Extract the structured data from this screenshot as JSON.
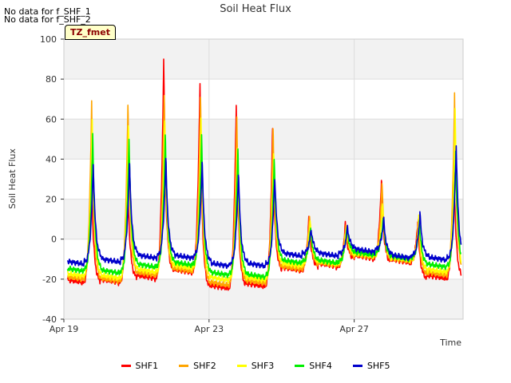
{
  "notices": [
    "No data for f_SHF_1",
    "No data for f_SHF_2"
  ],
  "badge": "TZ_fmet",
  "chart_data": {
    "type": "line",
    "title": "Soil Heat Flux",
    "xlabel": "Time",
    "ylabel": "Soil Heat Flux",
    "ylim": [
      -40,
      100
    ],
    "yticks": [
      -40,
      -20,
      0,
      20,
      40,
      60,
      80,
      100
    ],
    "xlim_days": [
      0,
      11
    ],
    "xticks": [
      {
        "label": "Apr 19",
        "day": 0
      },
      {
        "label": "Apr 23",
        "day": 4
      },
      {
        "label": "Apr 27",
        "day": 8
      }
    ],
    "grid": true,
    "legend_position": "bottom",
    "peak_days": [
      0.75,
      1.75,
      2.7,
      3.7,
      4.7,
      5.7,
      6.7,
      7.7,
      8.7,
      9.7,
      10.7
    ],
    "series": [
      {
        "name": "SHF1",
        "color": "#ff0000",
        "peaks": [
          40,
          36,
          90,
          79,
          68,
          55,
          10,
          7,
          30,
          8,
          32
        ],
        "nights": [
          -22,
          -22,
          -20,
          -17,
          -25,
          -24,
          -16,
          -14,
          -10,
          -12,
          -20
        ]
      },
      {
        "name": "SHF2",
        "color": "#ffa500",
        "peaks": [
          67,
          67,
          72,
          71,
          61,
          55,
          11,
          6,
          28,
          8,
          71
        ],
        "nights": [
          -20,
          -21,
          -18,
          -16,
          -23,
          -22,
          -15,
          -13,
          -9,
          -11,
          -18
        ]
      },
      {
        "name": "SHF3",
        "color": "#ffff00",
        "peaks": [
          58,
          58,
          60,
          60,
          44,
          42,
          9,
          6,
          18,
          9,
          62
        ],
        "nights": [
          -18,
          -19,
          -16,
          -14,
          -20,
          -20,
          -13,
          -12,
          -8,
          -10,
          -16
        ]
      },
      {
        "name": "SHF4",
        "color": "#00ee00",
        "peaks": [
          51,
          50,
          52,
          52,
          45,
          40,
          5,
          5,
          10,
          7,
          42
        ],
        "nights": [
          -15,
          -16,
          -13,
          -12,
          -17,
          -18,
          -11,
          -11,
          -7,
          -9,
          -13
        ]
      },
      {
        "name": "SHF5",
        "color": "#0000cc",
        "peaks": [
          36,
          37,
          39,
          38,
          33,
          31,
          4,
          5,
          9,
          12,
          46
        ],
        "nights": [
          -11,
          -10,
          -8,
          -8,
          -12,
          -12,
          -7,
          -7,
          -5,
          -8,
          -9
        ]
      }
    ]
  }
}
